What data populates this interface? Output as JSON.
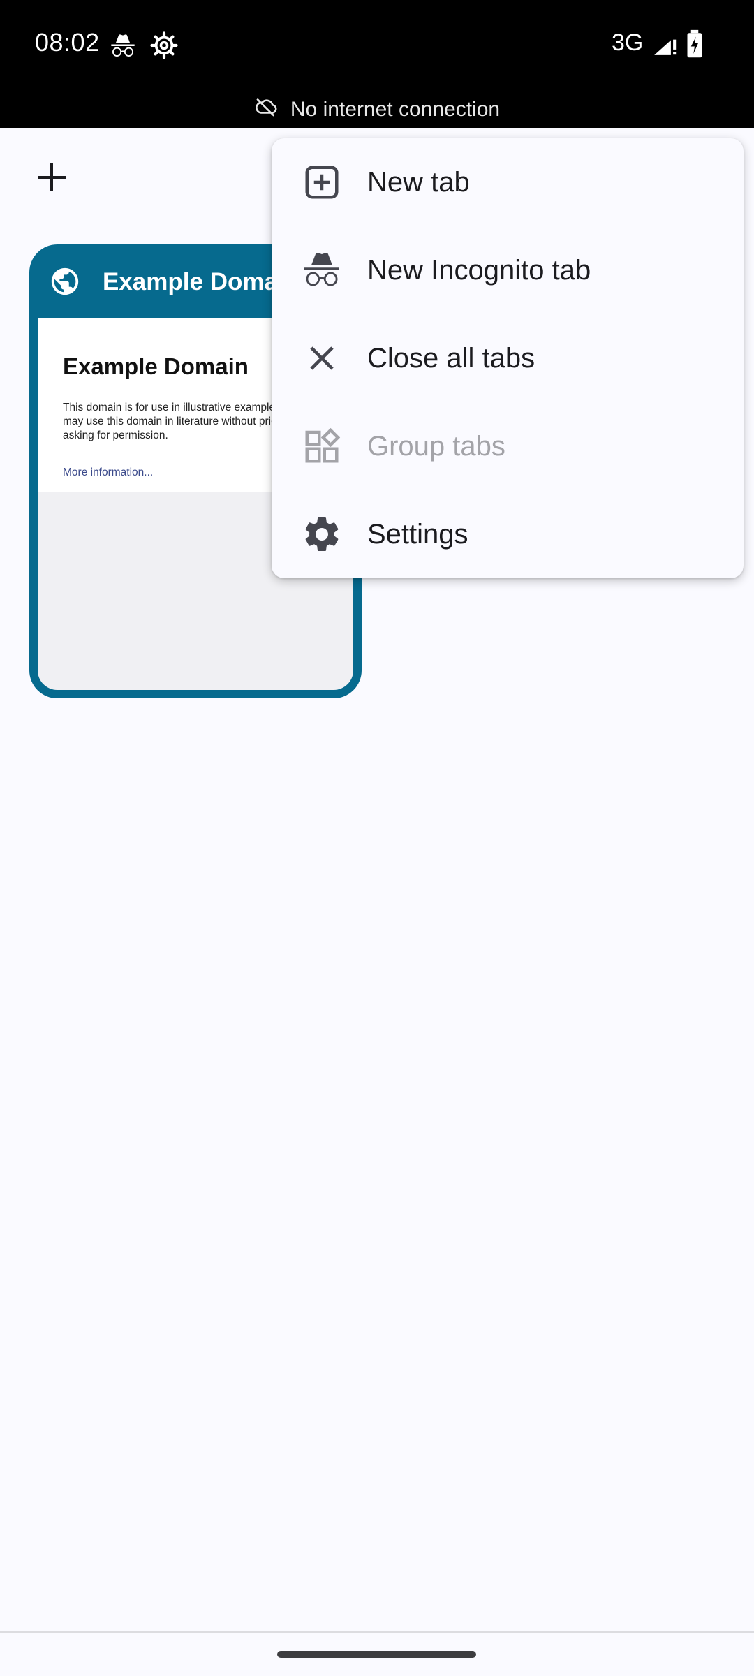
{
  "status_bar": {
    "time": "08:02",
    "network": "3G",
    "icons": [
      "incognito-icon",
      "settings-gear-icon",
      "signal-icon",
      "battery-charging-icon"
    ]
  },
  "offline_banner": {
    "text": "No internet connection",
    "icon": "cloud-off-icon"
  },
  "toolbar": {
    "new_tab_icon": "plus-icon"
  },
  "tab_card": {
    "title": "Example Domain",
    "favicon": "globe-icon",
    "accent_color": "#066a8e",
    "thumbnail": {
      "heading": "Example Domain",
      "body": "This domain is for use in illustrative examples in documents. You may use this domain in literature without prior coordination or asking for permission.",
      "link": "More information..."
    }
  },
  "menu": {
    "items": [
      {
        "label": "New tab",
        "icon": "new-tab-icon",
        "disabled": false
      },
      {
        "label": "New Incognito tab",
        "icon": "incognito-icon",
        "disabled": false
      },
      {
        "label": "Close all tabs",
        "icon": "close-icon",
        "disabled": false
      },
      {
        "label": "Group tabs",
        "icon": "group-tabs-icon",
        "disabled": true
      },
      {
        "label": "Settings",
        "icon": "gear-icon",
        "disabled": false
      }
    ]
  }
}
